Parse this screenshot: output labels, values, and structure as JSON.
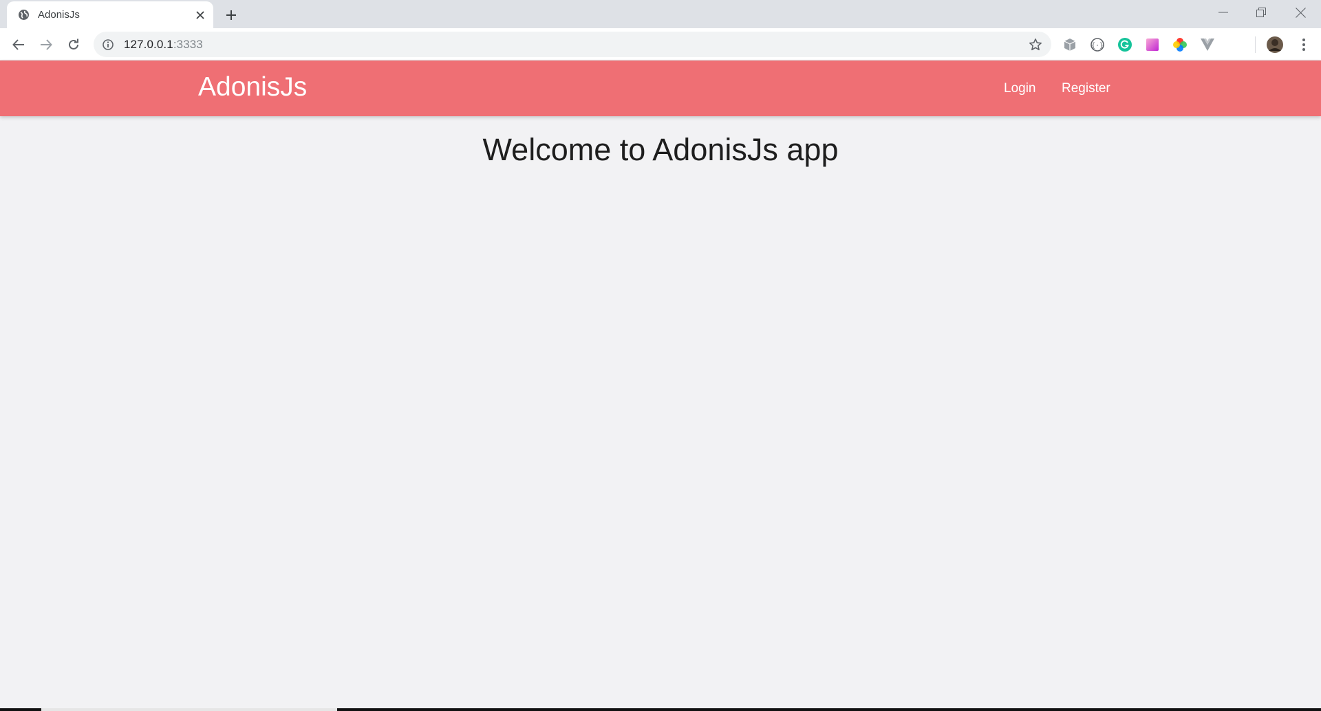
{
  "browser": {
    "tab": {
      "title": "AdonisJs"
    },
    "address": {
      "host": "127.0.0.1",
      "port": ":3333"
    },
    "extensions": [
      "cube-icon",
      "bracket-icon",
      "grammarly-icon",
      "gradient-icon",
      "color-wheel-icon",
      "vue-devtools-icon"
    ]
  },
  "navbar": {
    "brand": "AdonisJs",
    "links": {
      "login": "Login",
      "register": "Register"
    },
    "color": "#ef6f74"
  },
  "main": {
    "heading": "Welcome to AdonisJs app"
  }
}
